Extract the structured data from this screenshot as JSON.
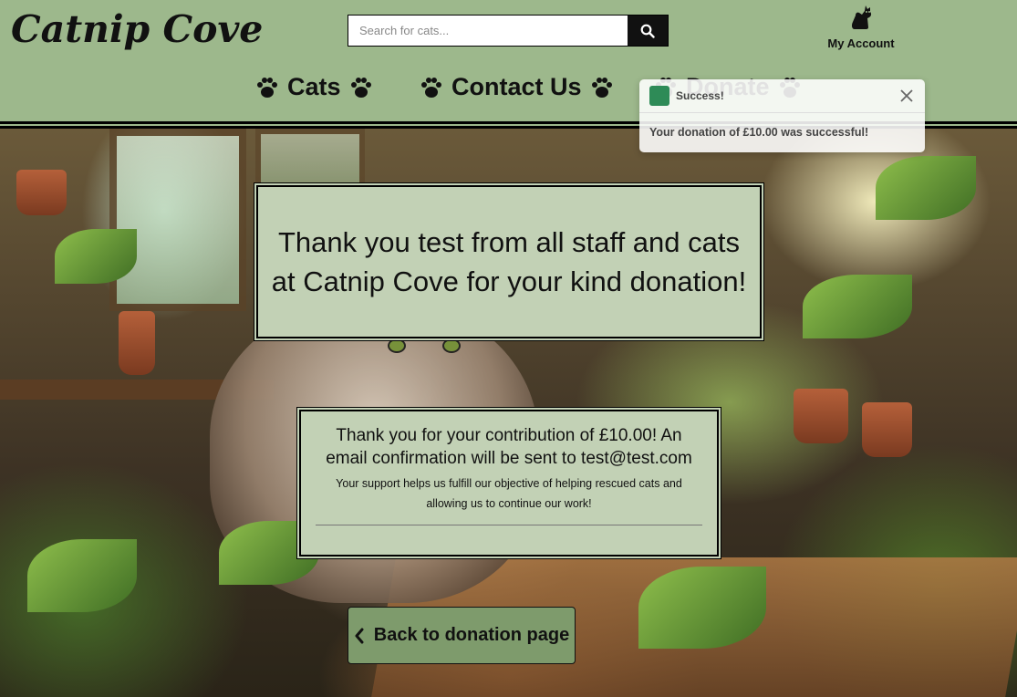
{
  "brand": {
    "name": "Catnip Cove"
  },
  "search": {
    "placeholder": "Search for cats...",
    "value": ""
  },
  "account": {
    "label": "My Account"
  },
  "nav": {
    "items": [
      {
        "label": "Cats"
      },
      {
        "label": "Contact Us"
      },
      {
        "label": "Donate"
      }
    ]
  },
  "toast": {
    "title": "Success!",
    "message": "Your donation of £10.00 was successful!",
    "accent": "#2e8b57"
  },
  "main": {
    "thanks_title": "Thank you test from all staff and cats at Catnip Cove for your kind donation!",
    "contribution_text": "Thank you for your contribution of £10.00! An email confirmation will be sent to test@test.com",
    "support_text": "Your support helps us fulfill our objective of helping rescued cats and allowing us to continue our work!",
    "back_button": "Back to donation page"
  },
  "colors": {
    "header_bg": "#9db88c",
    "panel_bg": "#c2d1b5",
    "button_bg": "#7e9b6c"
  }
}
